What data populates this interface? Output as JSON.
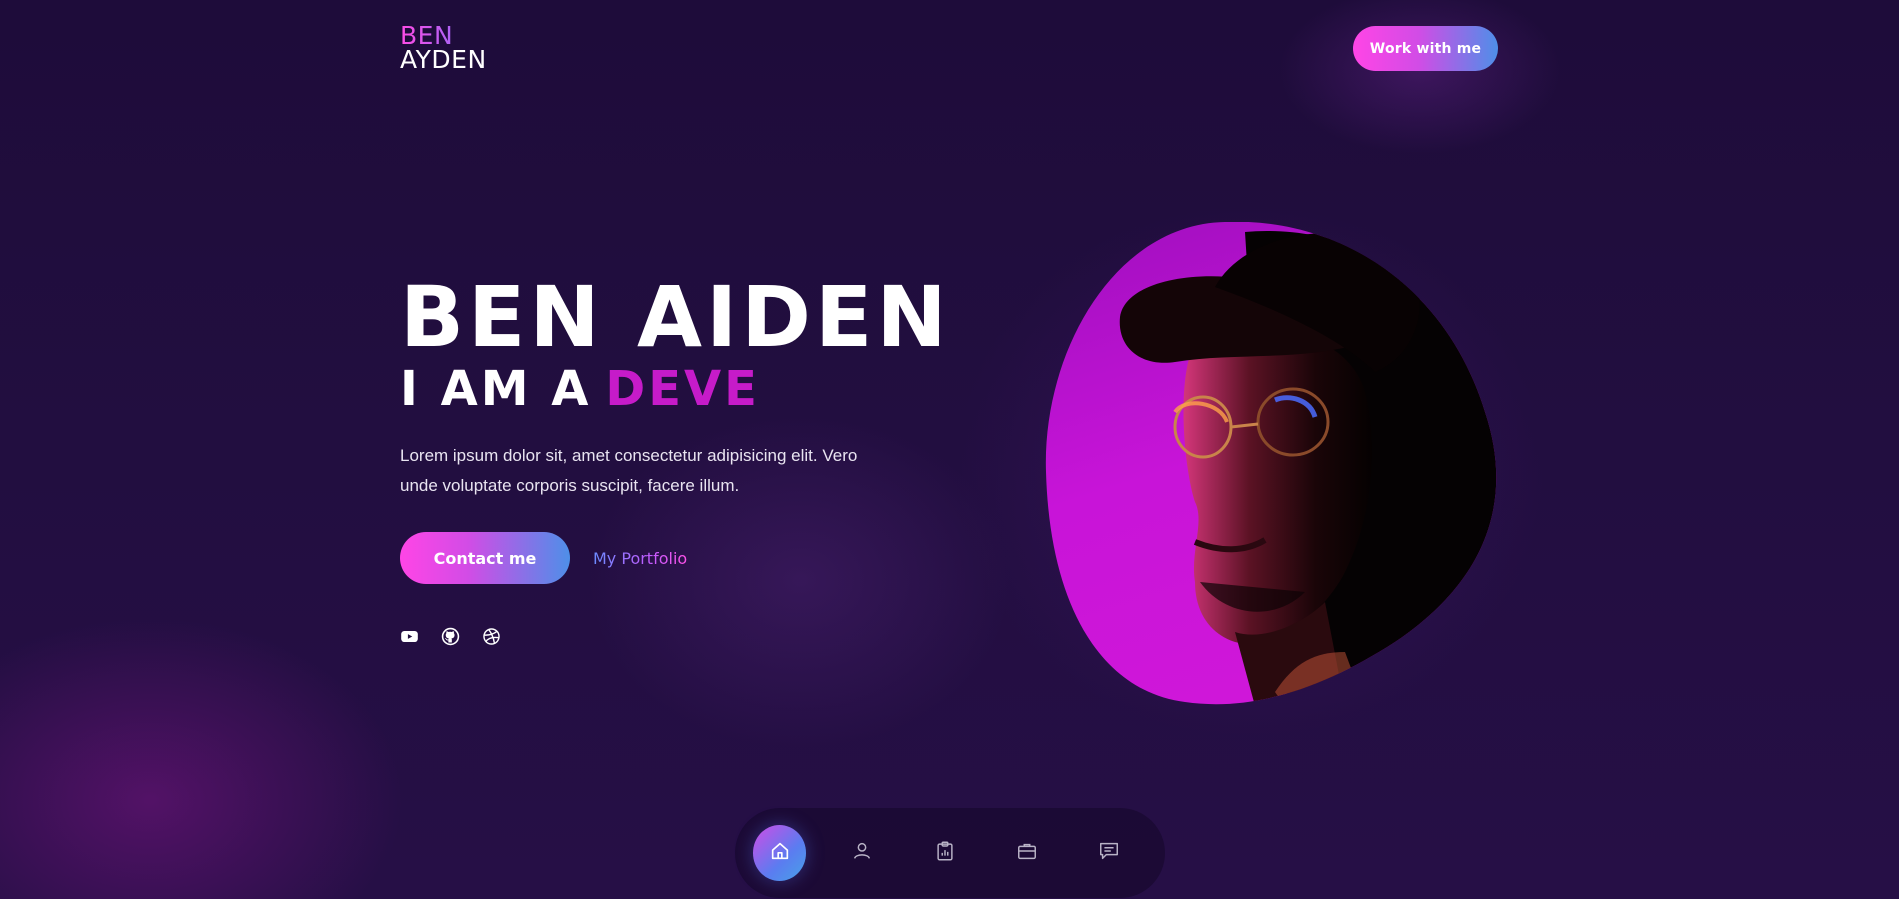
{
  "header": {
    "logo_line1": "BEN",
    "logo_line2": "AYDEN",
    "cta_label": "Work with me"
  },
  "hero": {
    "name": "BEN AIDEN",
    "role_prefix": "I AM A",
    "role_word": "DEVE",
    "description": "Lorem ipsum dolor sit, amet consectetur adipisicing elit. Vero unde voluptate corporis suscipit, facere illum.",
    "primary_button": "Contact me",
    "secondary_link": "My Portfolio"
  },
  "socials": [
    {
      "icon": "youtube-icon"
    },
    {
      "icon": "github-icon"
    },
    {
      "icon": "dribbble-icon"
    }
  ],
  "bottom_nav": {
    "items": [
      {
        "icon": "home-icon",
        "active": true
      },
      {
        "icon": "user-icon",
        "active": false
      },
      {
        "icon": "clipboard-chart-icon",
        "active": false
      },
      {
        "icon": "briefcase-icon",
        "active": false
      },
      {
        "icon": "message-icon",
        "active": false
      }
    ]
  },
  "colors": {
    "background": "#220e40",
    "accent_pink": "#ff45e6",
    "accent_blue": "#4e8fe8",
    "role_word": "#c61bc9",
    "portrait_backdrop": "#c012d6"
  }
}
